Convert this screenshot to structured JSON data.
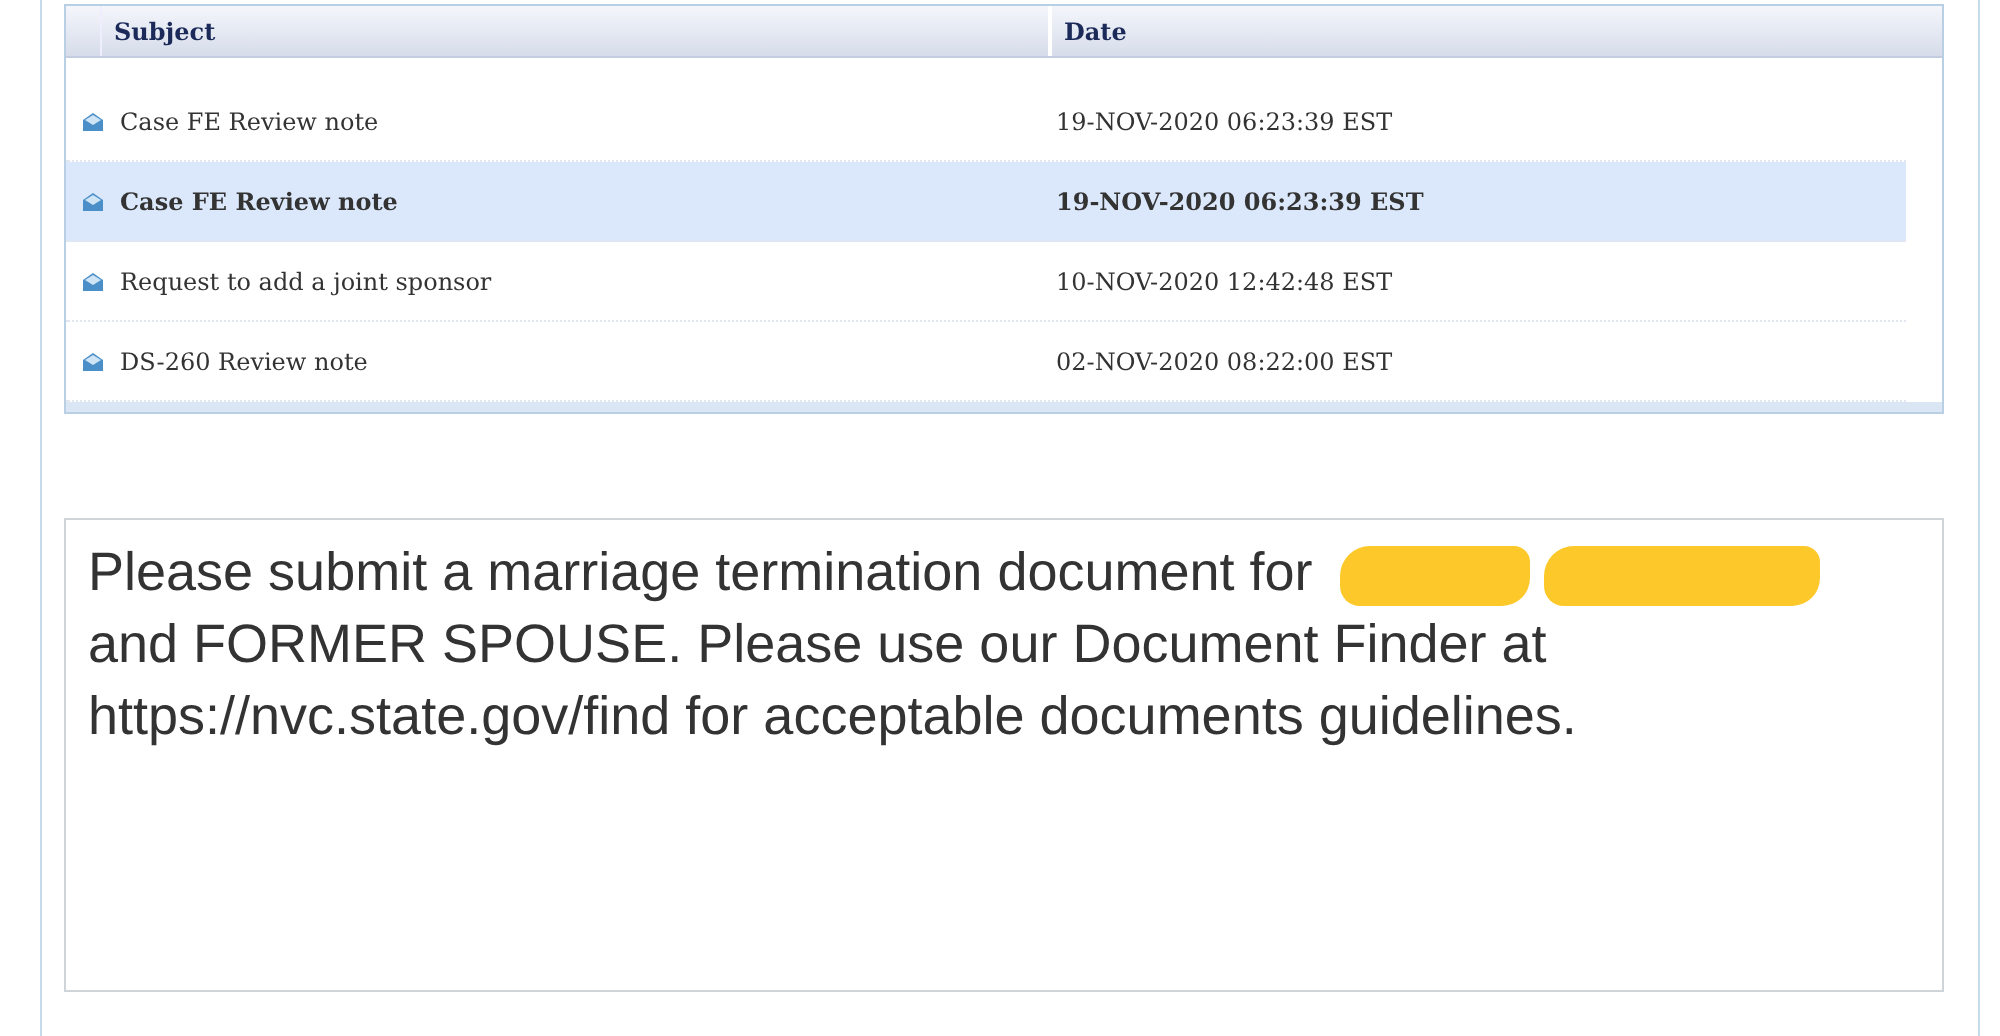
{
  "table": {
    "columns": [
      "Subject",
      "Date"
    ],
    "rows": [
      {
        "subject": "Case FE Review note",
        "date": "19-NOV-2020 06:23:39 EST",
        "selected": false
      },
      {
        "subject": "Case FE Review note",
        "date": "19-NOV-2020 06:23:39 EST",
        "selected": true
      },
      {
        "subject": "Request to add a joint sponsor",
        "date": "10-NOV-2020 12:42:48 EST",
        "selected": false
      },
      {
        "subject": "DS-260 Review note",
        "date": "02-NOV-2020 08:22:00 EST",
        "selected": false
      }
    ]
  },
  "message": {
    "parts": [
      {
        "kind": "text",
        "text": "Please submit a marriage termination document for"
      },
      {
        "kind": "redaction"
      },
      {
        "kind": "redaction"
      },
      {
        "kind": "text",
        "text": "and FORMER SPOUSE. Please use our Document Finder at https://nvc.state.gov/find for acceptable documents guidelines."
      }
    ]
  }
}
